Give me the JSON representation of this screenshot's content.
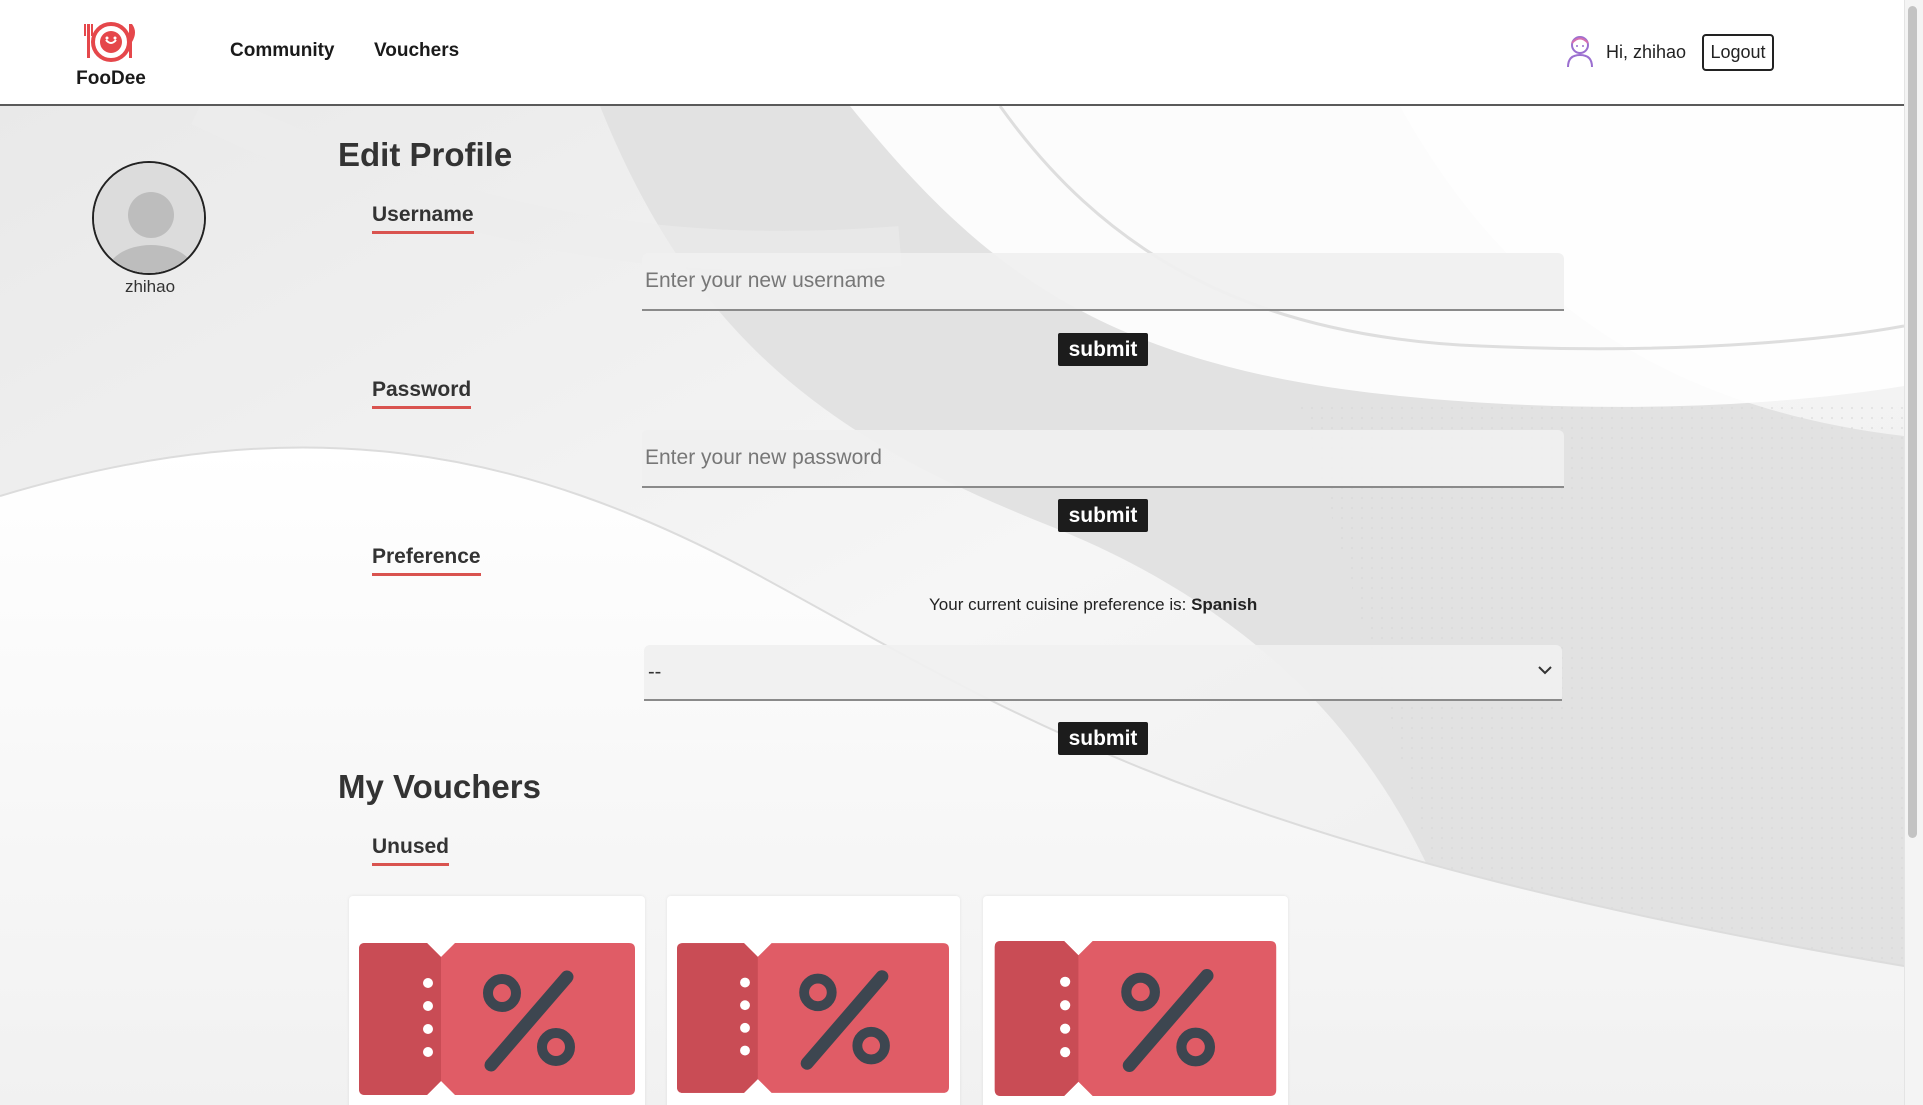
{
  "header": {
    "logo_text": "FooDee",
    "nav": [
      {
        "label": "Community"
      },
      {
        "label": "Vouchers"
      }
    ],
    "greeting": "Hi, zhihao",
    "logout_label": "Logout"
  },
  "profile": {
    "username": "zhihao",
    "title": "Edit Profile",
    "username_section": {
      "label": "Username",
      "placeholder": "Enter your new username",
      "value": "",
      "submit_label": "submit"
    },
    "password_section": {
      "label": "Password",
      "placeholder": "Enter your new password",
      "value": "",
      "submit_label": "submit"
    },
    "preference_section": {
      "label": "Preference",
      "current_text": "Your current cuisine preference is:",
      "current_value": "Spanish",
      "selected_option": "--",
      "submit_label": "submit"
    }
  },
  "vouchers": {
    "title": "My Vouchers",
    "tab_label": "Unused",
    "items": [
      {
        "icon": "percent-ticket-icon"
      },
      {
        "icon": "percent-ticket-icon"
      },
      {
        "icon": "percent-ticket-icon"
      }
    ]
  },
  "colors": {
    "accent": "#d9534f",
    "ticket_light": "#e05c66",
    "ticket_dark": "#c94c55",
    "percent_glyph": "#3d4650",
    "button": "#1c1c1c"
  }
}
